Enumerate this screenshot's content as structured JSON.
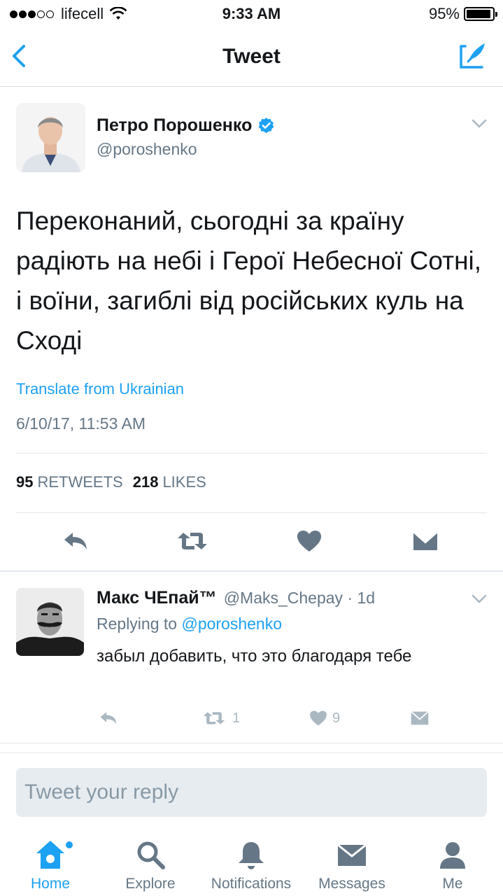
{
  "status_bar": {
    "carrier": "lifecell",
    "time": "9:33 AM",
    "battery_percent": "95%",
    "battery_level": 0.95,
    "signal_bars": 3,
    "signal_total": 5
  },
  "nav": {
    "title": "Tweet",
    "back_icon": "chevron-left-icon",
    "compose_icon": "compose-tweet-icon"
  },
  "colors": {
    "accent": "#1da1f2",
    "text": "#14171a",
    "secondary": "#657786",
    "divider": "#e1e8ed",
    "compose_bg": "#e6ecf0"
  },
  "tweet": {
    "author_name": "Петро Порошенко",
    "author_handle": "@poroshenko",
    "text": "Переконаний, сьогодні за країну радіють на небі і Герої Небесної Сотні, і воїни, загиблі від російських куль на Сході",
    "translate_label": "Translate from Ukrainian",
    "timestamp": "6/10/17, 11:53 AM",
    "retweets_count": "95",
    "retweets_label": "RETWEETS",
    "likes_count": "218",
    "likes_label": "LIKES"
  },
  "reply": {
    "author_name": "Макс ЧЕпай™",
    "author_handle": "@Maks_Chepay · 1d",
    "replying_prefix": "Replying to",
    "replying_handle": "@poroshenko",
    "text": "забыл добавить, что это благодаря тебе",
    "retweet_count": "1",
    "like_count": "9"
  },
  "compose": {
    "placeholder": "Tweet your reply"
  },
  "tabs": [
    {
      "label": "Home",
      "icon": "home-icon",
      "active": true,
      "has_dot": true
    },
    {
      "label": "Explore",
      "icon": "search-icon",
      "active": false
    },
    {
      "label": "Notifications",
      "icon": "bell-icon",
      "active": false
    },
    {
      "label": "Messages",
      "icon": "envelope-icon",
      "active": false
    },
    {
      "label": "Me",
      "icon": "person-icon",
      "active": false
    }
  ]
}
